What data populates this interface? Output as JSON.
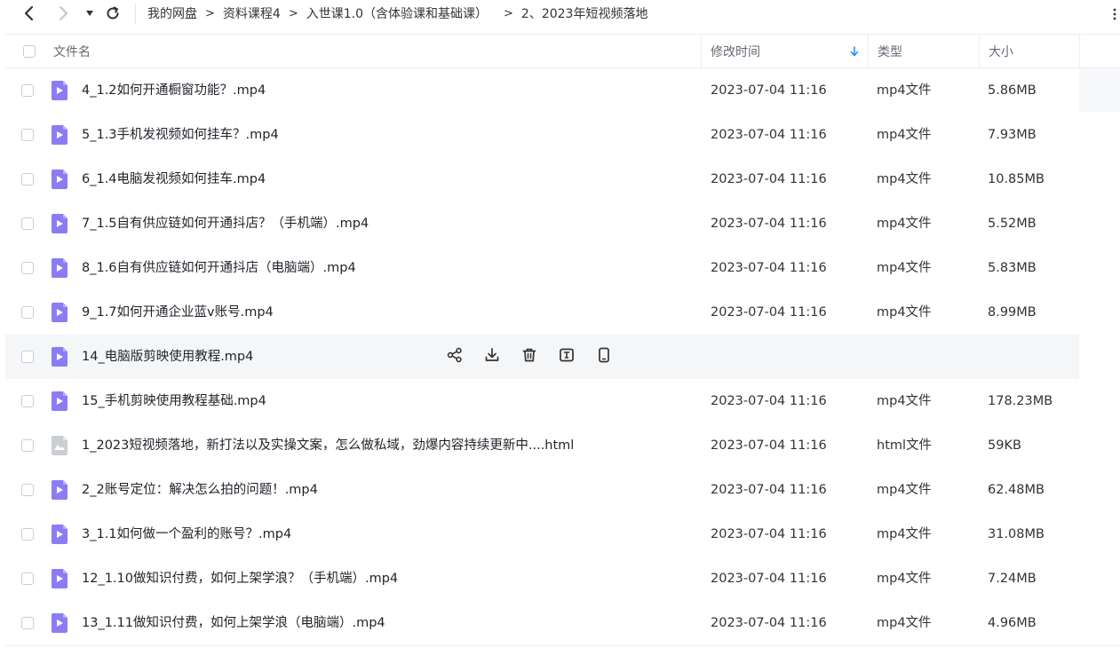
{
  "toolbar": {
    "breadcrumbs": [
      "我的网盘",
      "资料课程4",
      "入世课1.0（含体验课和基础课）",
      "2、2023年短视频落地"
    ],
    "separator": ">"
  },
  "table": {
    "columns": {
      "name": "文件名",
      "modified": "修改时间",
      "type": "类型",
      "size": "大小"
    },
    "sort_column": "modified",
    "rows": [
      {
        "name": "4_1.2如何开通橱窗功能？.mp4",
        "date": "2023-07-04 11:16",
        "type": "mp4文件",
        "size": "5.86MB",
        "icon": "video-file-icon"
      },
      {
        "name": "5_1.3手机发视频如何挂车？.mp4",
        "date": "2023-07-04 11:16",
        "type": "mp4文件",
        "size": "7.93MB",
        "icon": "video-file-icon"
      },
      {
        "name": "6_1.4电脑发视频如何挂车.mp4",
        "date": "2023-07-04 11:16",
        "type": "mp4文件",
        "size": "10.85MB",
        "icon": "video-file-icon"
      },
      {
        "name": "7_1.5自有供应链如何开通抖店？（手机端）.mp4",
        "date": "2023-07-04 11:16",
        "type": "mp4文件",
        "size": "5.52MB",
        "icon": "video-file-icon"
      },
      {
        "name": "8_1.6自有供应链如何开通抖店（电脑端）.mp4",
        "date": "2023-07-04 11:16",
        "type": "mp4文件",
        "size": "5.83MB",
        "icon": "video-file-icon"
      },
      {
        "name": "9_1.7如何开通企业蓝v账号.mp4",
        "date": "2023-07-04 11:16",
        "type": "mp4文件",
        "size": "8.99MB",
        "icon": "video-file-icon"
      },
      {
        "name": "14_电脑版剪映使用教程.mp4",
        "date": "",
        "type": "",
        "size": "",
        "icon": "video-file-icon",
        "hover": true
      },
      {
        "name": "15_手机剪映使用教程基础.mp4",
        "date": "2023-07-04 11:16",
        "type": "mp4文件",
        "size": "178.23MB",
        "icon": "video-file-icon"
      },
      {
        "name": "1_2023短视频落地，新打法以及实操文案，怎么做私域，劲爆内容持续更新中....html",
        "date": "2023-07-04 11:16",
        "type": "html文件",
        "size": "59KB",
        "icon": "html-file-icon"
      },
      {
        "name": "2_2账号定位：解决怎么拍的问题！.mp4",
        "date": "2023-07-04 11:16",
        "type": "mp4文件",
        "size": "62.48MB",
        "icon": "video-file-icon"
      },
      {
        "name": "3_1.1如何做一个盈利的账号？.mp4",
        "date": "2023-07-04 11:16",
        "type": "mp4文件",
        "size": "31.08MB",
        "icon": "video-file-icon"
      },
      {
        "name": "12_1.10做知识付费，如何上架学浪？（手机端）.mp4",
        "date": "2023-07-04 11:16",
        "type": "mp4文件",
        "size": "7.24MB",
        "icon": "video-file-icon"
      },
      {
        "name": "13_1.11做知识付费，如何上架学浪（电脑端）.mp4",
        "date": "2023-07-04 11:16",
        "type": "mp4文件",
        "size": "4.96MB",
        "icon": "video-file-icon"
      }
    ],
    "hover_actions": [
      "share-icon",
      "download-icon",
      "delete-icon",
      "rename-icon",
      "send-to-phone-icon"
    ]
  },
  "colors": {
    "video_icon": "#8b7cf6",
    "html_icon": "#c9cdd4",
    "sort_arrow": "#1e90ff",
    "hover_row": "#f5f6f8"
  }
}
